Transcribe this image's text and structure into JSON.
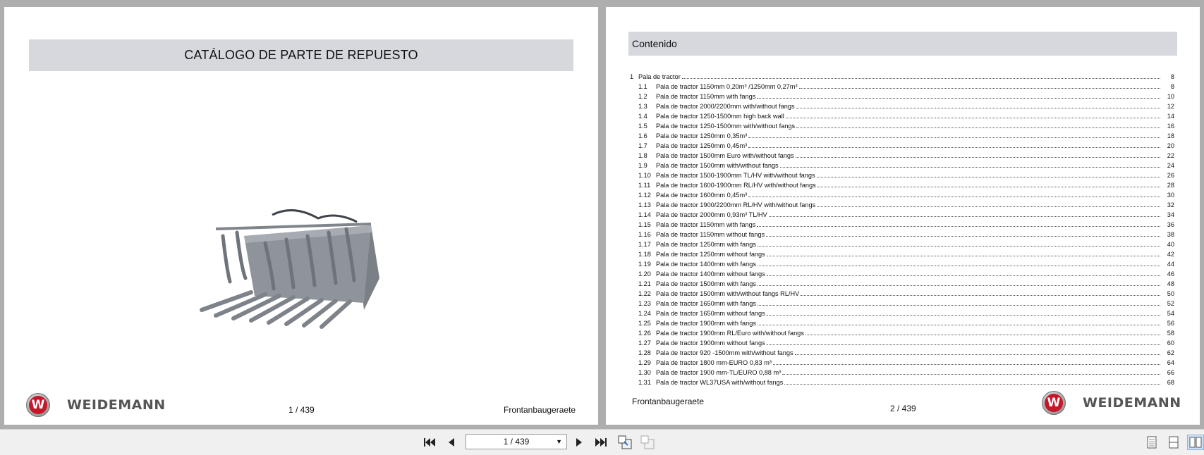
{
  "page1": {
    "title": "CATÁLOGO DE PARTE DE REPUESTO",
    "brand": "WEIDEMANN",
    "page_number": "1 / 439",
    "footer_right": "Frontanbaugeraete"
  },
  "page2": {
    "contents_title": "Contenido",
    "footer_left": "Frontanbaugeraete",
    "page_number": "2 / 439",
    "brand": "WEIDEMANN",
    "toc": [
      {
        "num": "1",
        "title": "Pala de tractor",
        "page": "8"
      },
      {
        "num": "1.1",
        "title": "Pala de tractor 1150mm 0,20m³ /1250mm 0,27m³",
        "page": "8"
      },
      {
        "num": "1.2",
        "title": "Pala de tractor 1150mm with fangs",
        "page": "10"
      },
      {
        "num": "1.3",
        "title": "Pala de tractor 2000/2200mm with/without fangs",
        "page": "12"
      },
      {
        "num": "1.4",
        "title": "Pala de tractor 1250-1500mm high back wall",
        "page": "14"
      },
      {
        "num": "1.5",
        "title": "Pala de tractor 1250-1500mm with/without fangs",
        "page": "16"
      },
      {
        "num": "1.6",
        "title": "Pala de tractor 1250mm 0,35m³",
        "page": "18"
      },
      {
        "num": "1.7",
        "title": "Pala de tractor 1250mm 0,45m³",
        "page": "20"
      },
      {
        "num": "1.8",
        "title": "Pala de tractor 1500mm Euro with/without fangs",
        "page": "22"
      },
      {
        "num": "1.9",
        "title": "Pala de tractor 1500mm with/without fangs",
        "page": "24"
      },
      {
        "num": "1.10",
        "title": "Pala de tractor 1500-1900mm TL/HV with/without fangs",
        "page": "26"
      },
      {
        "num": "1.11",
        "title": "Pala de tractor 1600-1900mm RL/HV with/without fangs",
        "page": "28"
      },
      {
        "num": "1.12",
        "title": "Pala de tractor 1600mm 0,45m³",
        "page": "30"
      },
      {
        "num": "1.13",
        "title": "Pala de tractor 1900/2200mm RL/HV with/without fangs",
        "page": "32"
      },
      {
        "num": "1.14",
        "title": "Pala de tractor 2000mm 0,93m³ TL/HV",
        "page": "34"
      },
      {
        "num": "1.15",
        "title": "Pala de tractor 1150mm with fangs",
        "page": "36"
      },
      {
        "num": "1.16",
        "title": "Pala de tractor 1150mm without fangs",
        "page": "38"
      },
      {
        "num": "1.17",
        "title": "Pala de tractor 1250mm with fangs",
        "page": "40"
      },
      {
        "num": "1.18",
        "title": "Pala de tractor 1250mm without fangs",
        "page": "42"
      },
      {
        "num": "1.19",
        "title": "Pala de tractor 1400mm with fangs",
        "page": "44"
      },
      {
        "num": "1.20",
        "title": "Pala de tractor 1400mm without fangs",
        "page": "46"
      },
      {
        "num": "1.21",
        "title": "Pala de tractor 1500mm with fangs",
        "page": "48"
      },
      {
        "num": "1.22",
        "title": "Pala de tractor 1500mm with/without fangs RL/HV",
        "page": "50"
      },
      {
        "num": "1.23",
        "title": "Pala de tractor 1650mm with fangs",
        "page": "52"
      },
      {
        "num": "1.24",
        "title": "Pala de tractor 1650mm without fangs",
        "page": "54"
      },
      {
        "num": "1.25",
        "title": "Pala de tractor 1900mm with fangs",
        "page": "56"
      },
      {
        "num": "1.26",
        "title": "Pala de tractor 1900mm RL/Euro with/without fangs",
        "page": "58"
      },
      {
        "num": "1.27",
        "title": "Pala de tractor 1900mm without fangs",
        "page": "60"
      },
      {
        "num": "1.28",
        "title": "Pala de tractor 920 -1500mm with/without fangs",
        "page": "62"
      },
      {
        "num": "1.29",
        "title": "Pala de tractor 1800 mm-EURO 0,83 m³",
        "page": "64"
      },
      {
        "num": "1.30",
        "title": "Pala de tractor 1900 mm-TL/EURO 0,88 m³",
        "page": "66"
      },
      {
        "num": "1.31",
        "title": "Pala de tractor WL37USA with/without fangs",
        "page": "68"
      }
    ]
  },
  "toolbar": {
    "page_field_value": "1 / 439",
    "icons": [
      "first-page-icon",
      "previous-page-icon",
      "next-page-icon",
      "last-page-icon",
      "fit-page-icon",
      "fit-width-icon",
      "single-page-view-icon",
      "continuous-view-icon",
      "two-page-view-icon"
    ]
  },
  "colors": {
    "band": "#d6d8de",
    "logo_red": "#c7152a",
    "frame": "#aeaeae"
  }
}
